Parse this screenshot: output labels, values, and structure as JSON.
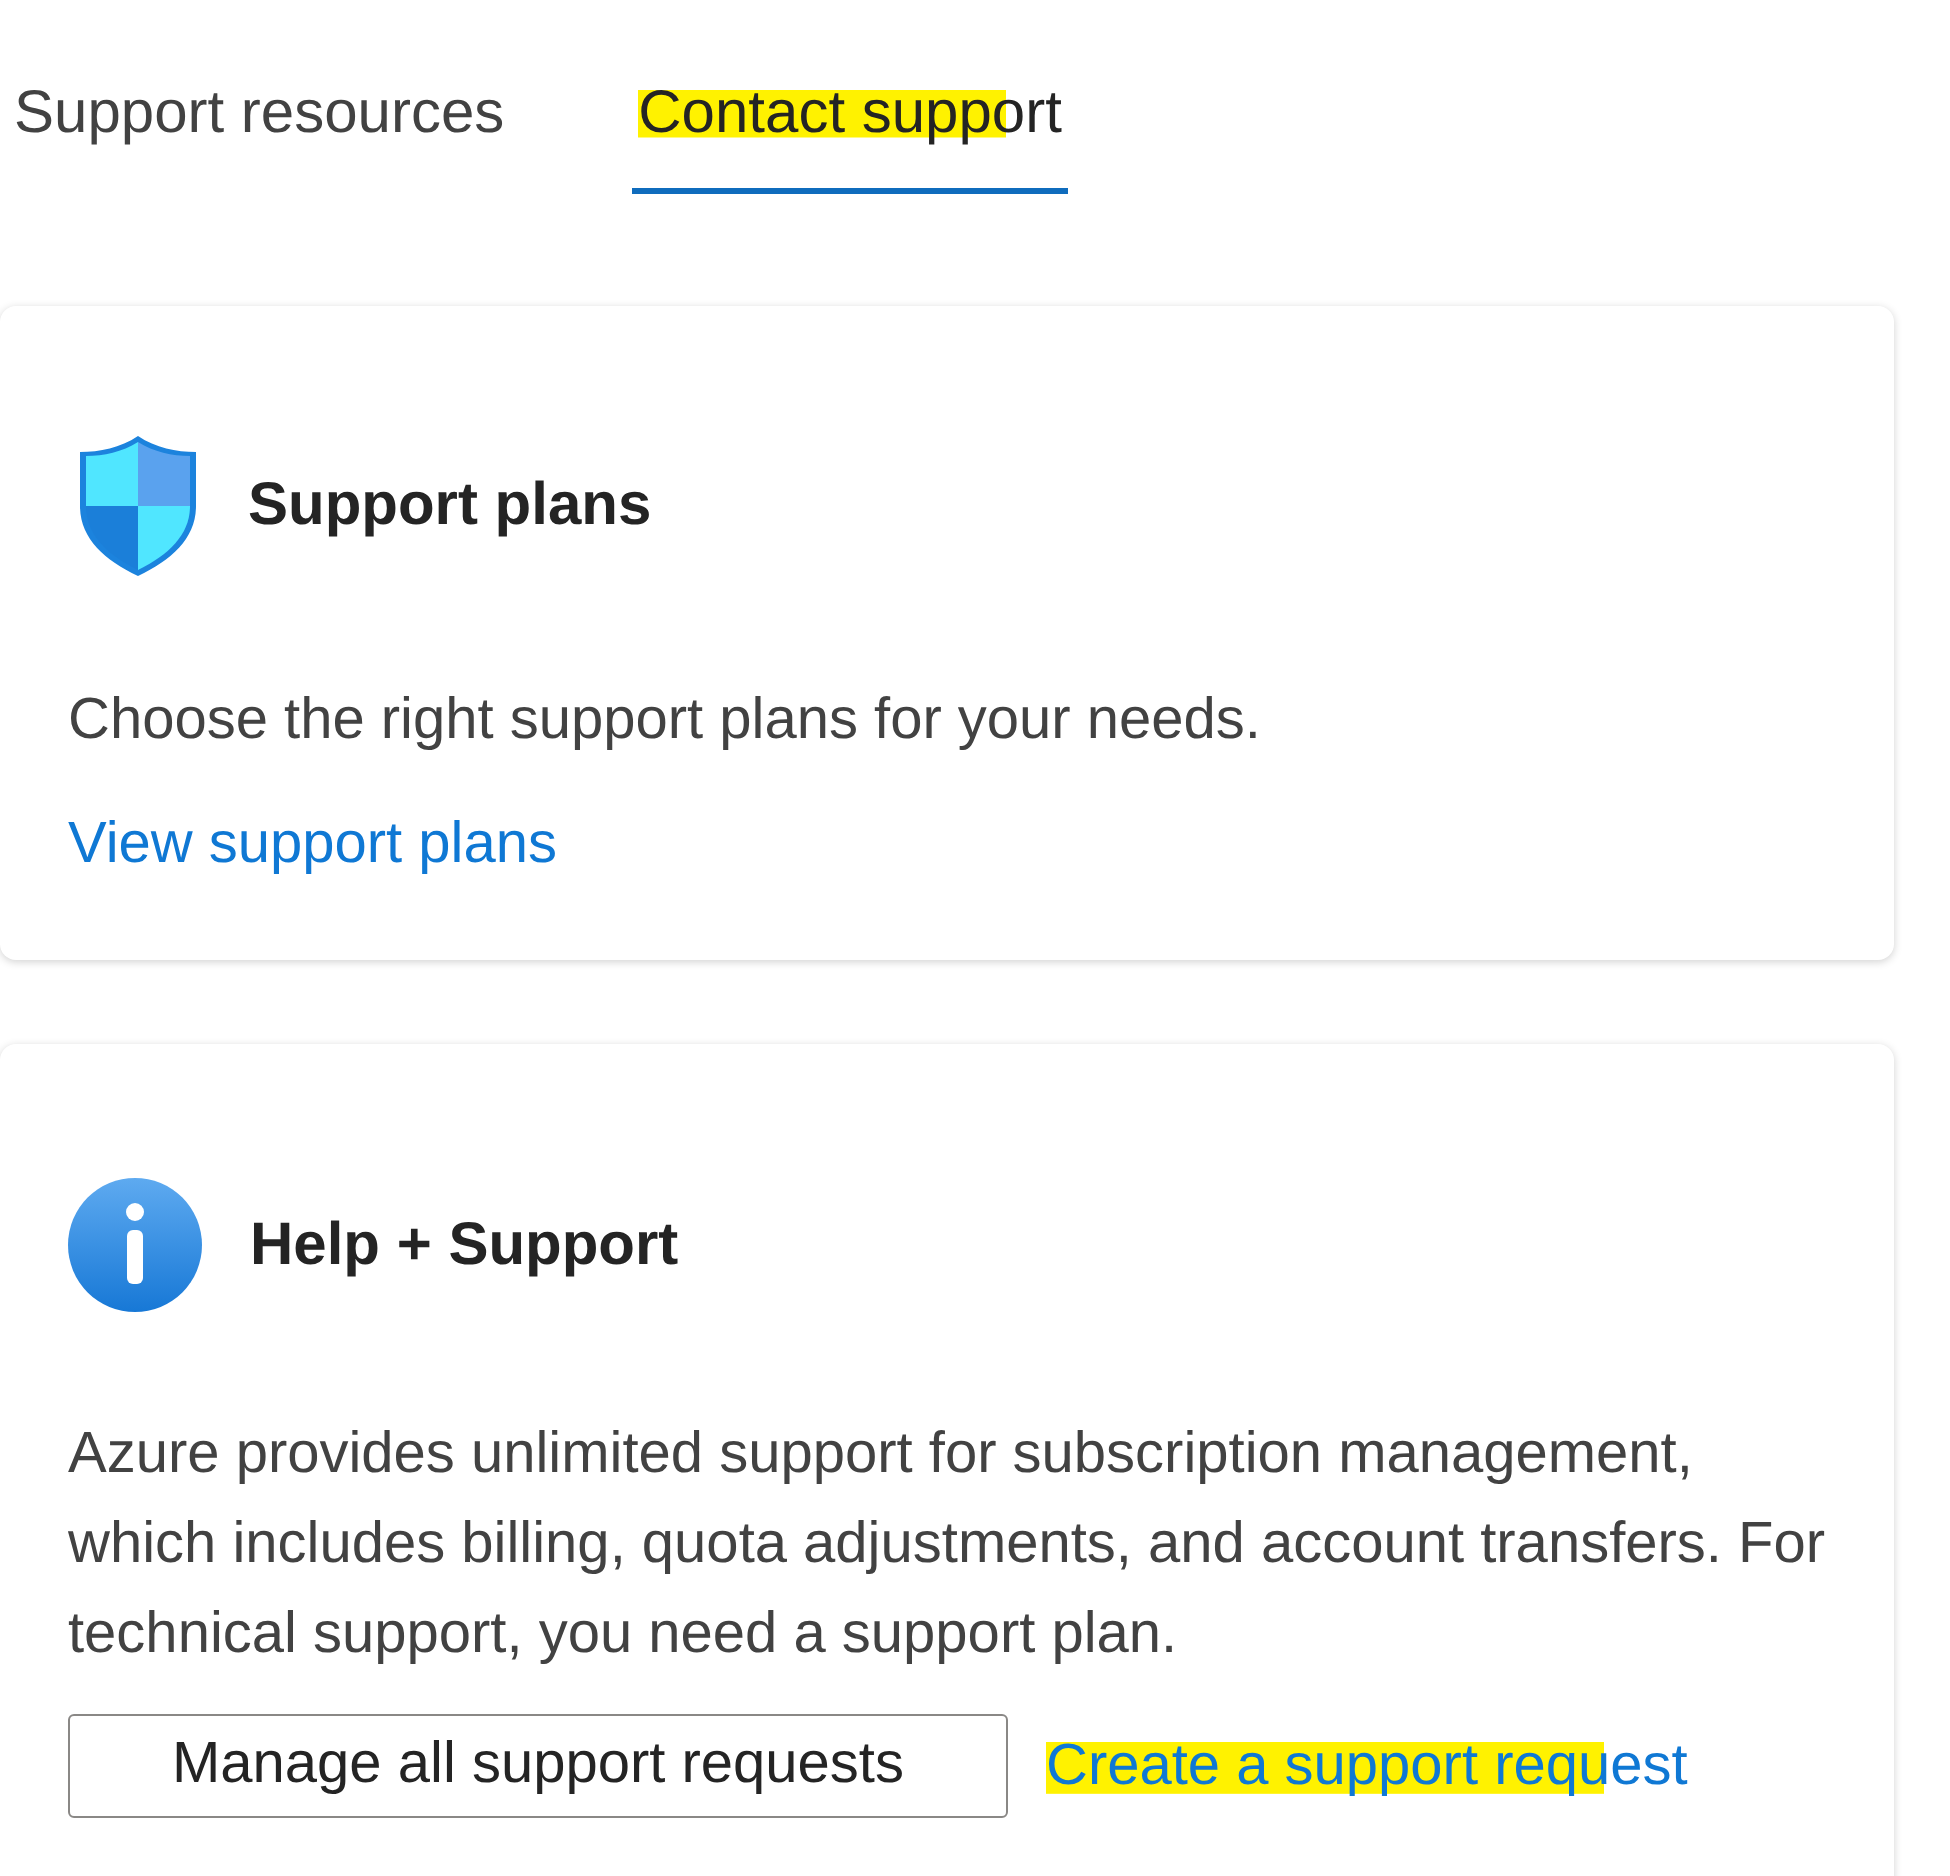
{
  "tabs": [
    {
      "label": "Support resources",
      "selected": false,
      "highlighted": false
    },
    {
      "label": "Contact support",
      "selected": true,
      "highlighted": true
    }
  ],
  "cards": [
    {
      "title": "Support plans",
      "description": "Choose the right support plans for your needs.",
      "actions": [
        {
          "kind": "link",
          "label": "View support plans",
          "highlighted": false
        }
      ]
    },
    {
      "title": "Help + Support",
      "description": "Azure provides unlimited support for subscription management, which includes billing, quota adjustments, and account transfers. For technical support, you need a support plan.",
      "actions": [
        {
          "kind": "button",
          "label": "Manage all support requests",
          "highlighted": false
        },
        {
          "kind": "link",
          "label": "Create a support request",
          "highlighted": true
        }
      ]
    }
  ]
}
